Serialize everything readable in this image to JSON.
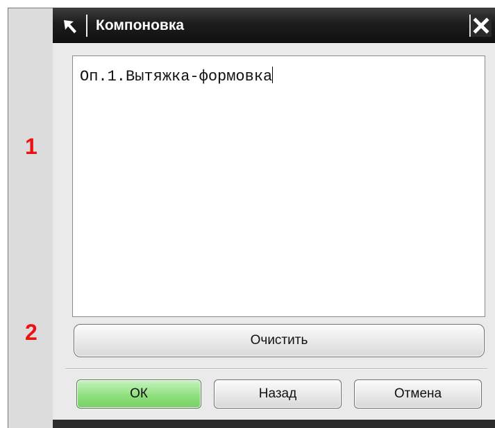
{
  "callouts": {
    "one": "1",
    "two": "2"
  },
  "dialog": {
    "title": "Компоновка",
    "text_value": "Оп.1.Вытяжка-формовка",
    "clear_label": "Очистить",
    "ok_label": "ОК",
    "back_label": "Назад",
    "cancel_label": "Отмена"
  },
  "icons": {
    "title": "pointer-arrow-icon",
    "close": "close-icon"
  },
  "colors": {
    "callout": "#ee1111",
    "titlebar": "#1c1c1c",
    "ok_button": "#8fe07e"
  }
}
